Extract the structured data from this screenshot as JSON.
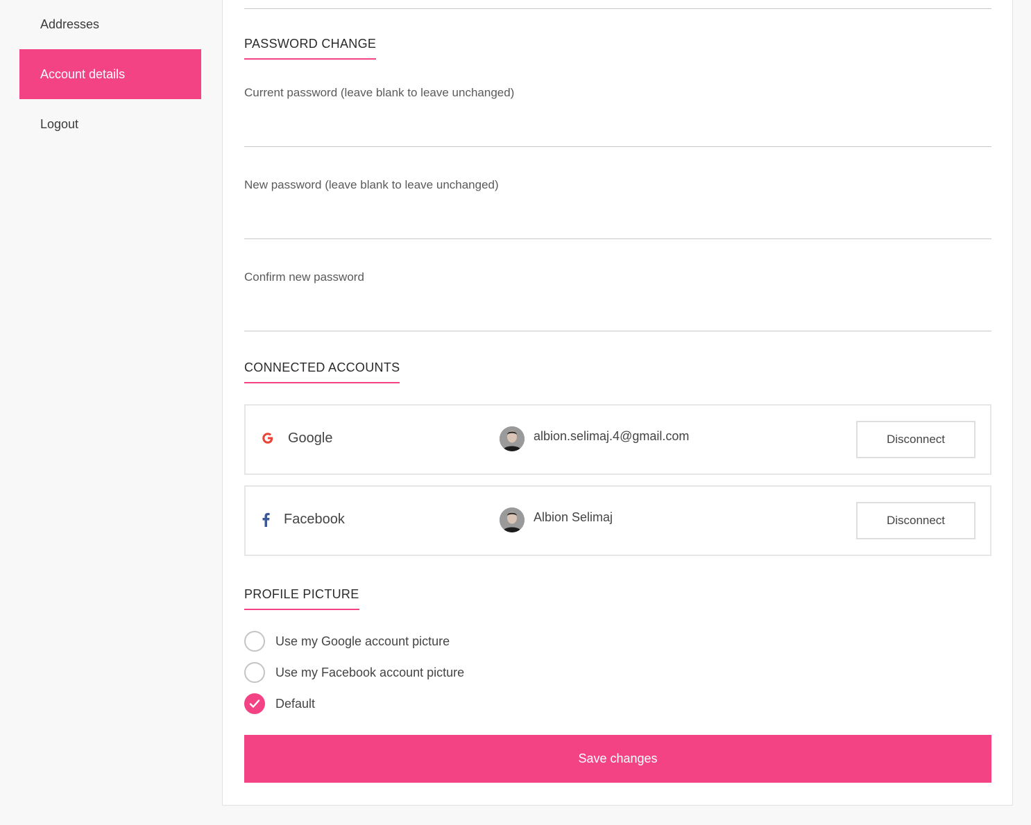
{
  "sidebar": {
    "items": [
      {
        "label": "Addresses"
      },
      {
        "label": "Account details"
      },
      {
        "label": "Logout"
      }
    ]
  },
  "password_change": {
    "title": "PASSWORD CHANGE",
    "current_label": "Current password (leave blank to leave unchanged)",
    "new_label": "New password (leave blank to leave unchanged)",
    "confirm_label": "Confirm new password"
  },
  "connected_accounts": {
    "title": "CONNECTED ACCOUNTS",
    "accounts": [
      {
        "provider": "Google",
        "icon": "google-icon",
        "icon_color": "#ea4335",
        "identity": "albion.selimaj.4@gmail.com",
        "action": "Disconnect"
      },
      {
        "provider": "Facebook",
        "icon": "facebook-icon",
        "icon_color": "#3b5998",
        "identity": "Albion Selimaj",
        "action": "Disconnect"
      }
    ]
  },
  "profile_picture": {
    "title": "PROFILE PICTURE",
    "options": [
      {
        "label": "Use my Google account picture",
        "checked": false
      },
      {
        "label": "Use my Facebook account picture",
        "checked": false
      },
      {
        "label": "Default",
        "checked": true
      }
    ]
  },
  "save_label": "Save changes",
  "colors": {
    "accent": "#f34385"
  }
}
